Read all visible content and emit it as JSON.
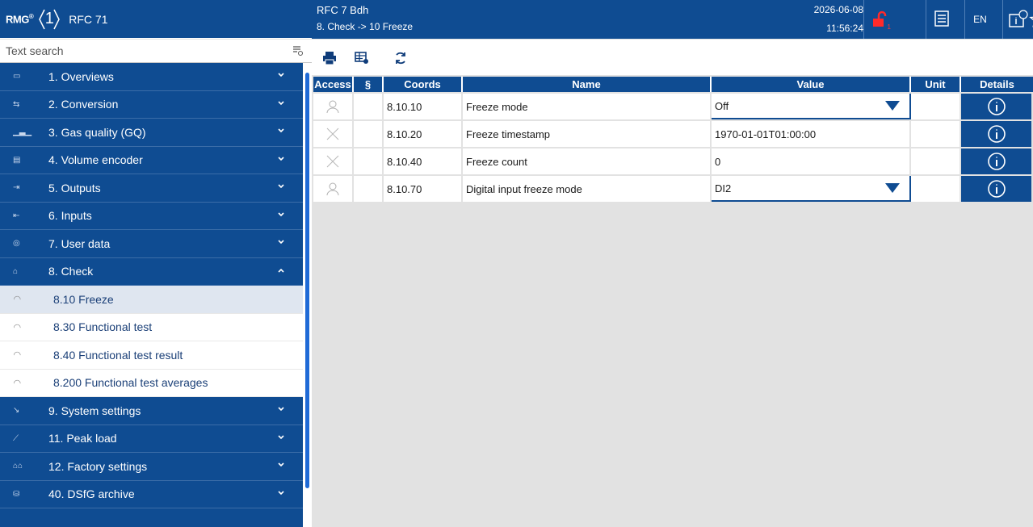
{
  "header": {
    "logo": "RMG",
    "logo_mark": "®",
    "device_number": "1",
    "device_name": "RFC 71",
    "title_line1": "RFC 7  Bdh",
    "title_line2": "8. Check -> 10 Freeze",
    "date": "2026-06-08",
    "time": "11:56:24",
    "lock_count": "1",
    "language": "EN",
    "info_count": "1"
  },
  "search": {
    "placeholder": "Text search"
  },
  "sidebar": {
    "items": [
      {
        "label": "1. Overviews",
        "icon": "overview-icon"
      },
      {
        "label": "2. Conversion",
        "icon": "conversion-icon"
      },
      {
        "label": "3. Gas quality (GQ)",
        "icon": "gas-quality-icon"
      },
      {
        "label": "4. Volume encoder",
        "icon": "volume-encoder-icon"
      },
      {
        "label": "5. Outputs",
        "icon": "outputs-icon"
      },
      {
        "label": "6. Inputs",
        "icon": "inputs-icon"
      },
      {
        "label": "7. User data",
        "icon": "user-data-icon"
      },
      {
        "label": "8. Check",
        "icon": "check-icon"
      }
    ],
    "subitems": [
      {
        "label": "8.10 Freeze"
      },
      {
        "label": "8.30 Functional test"
      },
      {
        "label": "8.40 Functional test result"
      },
      {
        "label": "8.200 Functional test averages"
      }
    ],
    "items_after": [
      {
        "label": "9. System settings",
        "icon": "system-settings-icon"
      },
      {
        "label": "11. Peak load",
        "icon": "peak-load-icon"
      },
      {
        "label": "12. Factory settings",
        "icon": "factory-settings-icon"
      },
      {
        "label": "40. DSfG archive",
        "icon": "archive-icon"
      }
    ]
  },
  "table": {
    "headers": {
      "access": "Access",
      "section": "§",
      "coords": "Coords",
      "name": "Name",
      "value": "Value",
      "unit": "Unit",
      "details": "Details"
    },
    "rows": [
      {
        "access": "user-icon",
        "coords": "8.10.10",
        "name": "Freeze mode",
        "value": "Off",
        "dropdown": true
      },
      {
        "access": "cross-icon",
        "coords": "8.10.20",
        "name": "Freeze timestamp",
        "value": "1970-01-01T01:00:00",
        "dropdown": false
      },
      {
        "access": "cross-icon",
        "coords": "8.10.40",
        "name": "Freeze count",
        "value": "0",
        "dropdown": false
      },
      {
        "access": "user-icon",
        "coords": "8.10.70",
        "name": "Digital input freeze mode",
        "value": "DI2",
        "dropdown": true
      }
    ]
  },
  "colors": {
    "primary": "#0f4c92",
    "background": "#e2e2e2",
    "lock": "#ff2a2a"
  }
}
